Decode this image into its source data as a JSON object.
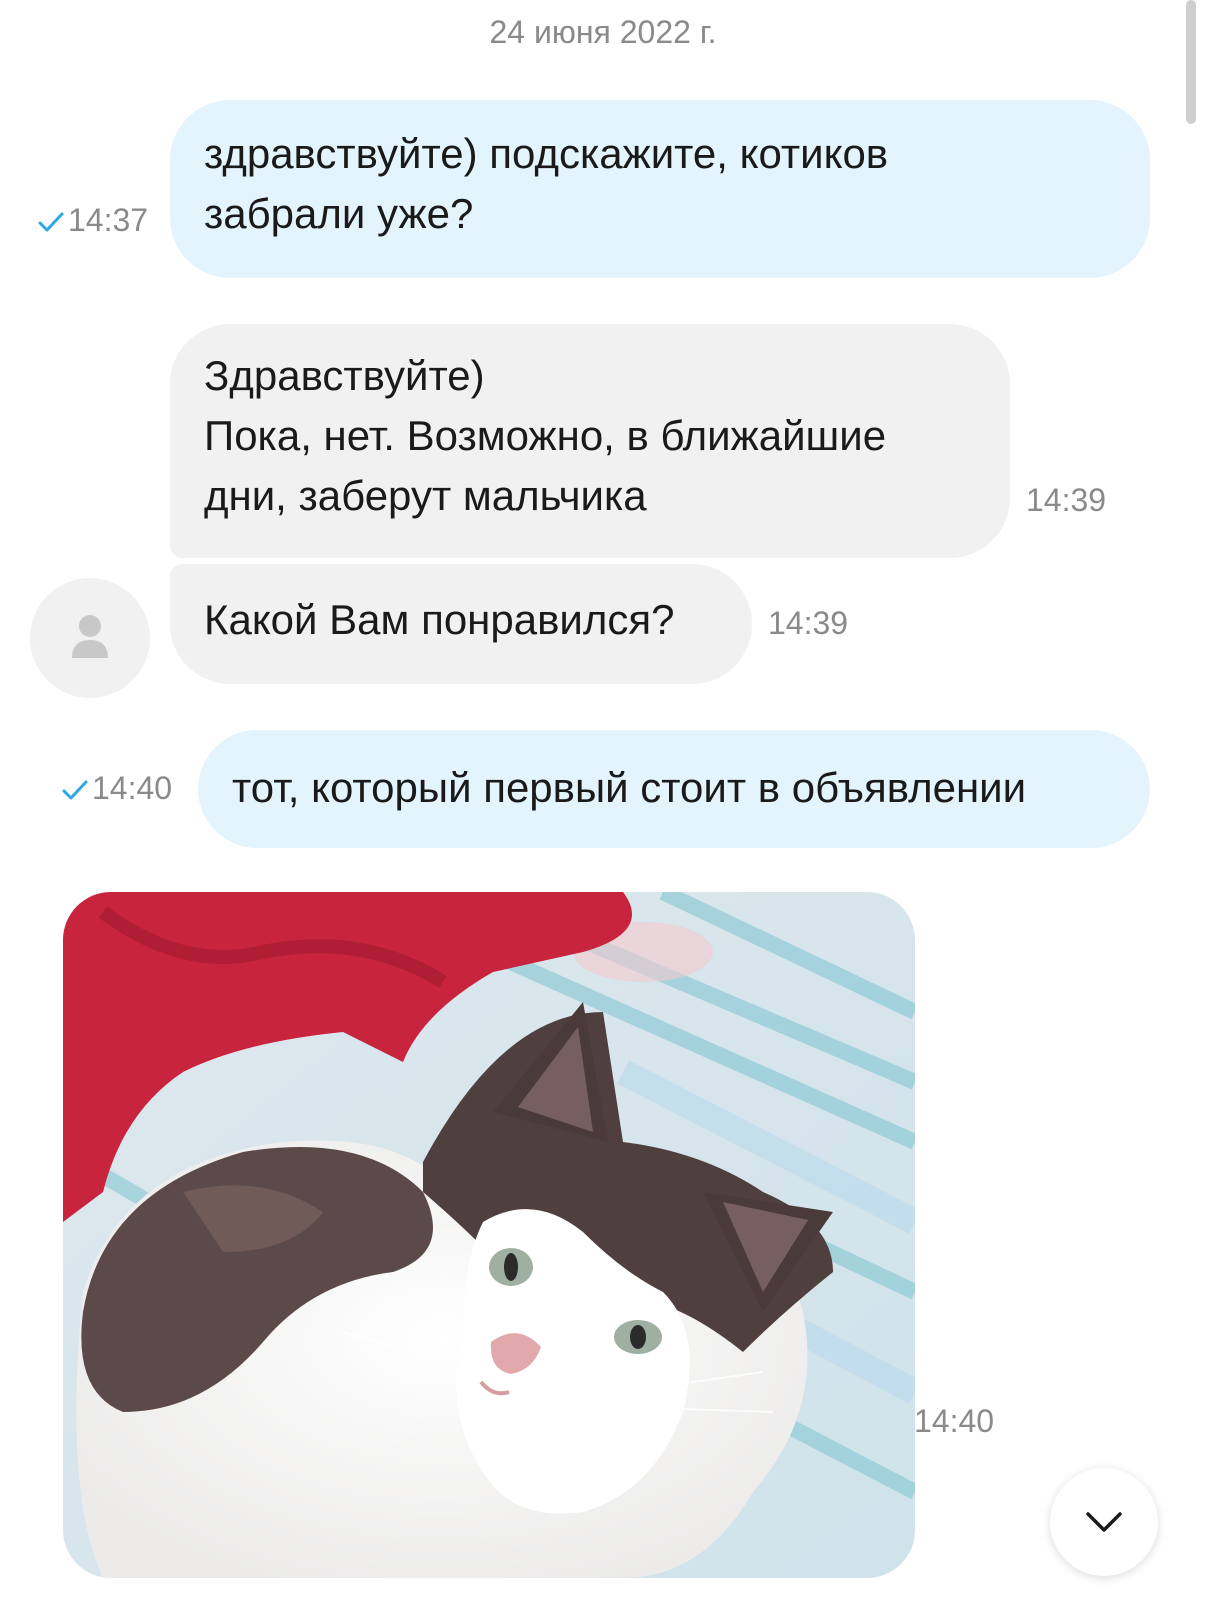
{
  "date_separator": "24 июня 2022 г.",
  "messages": [
    {
      "direction": "outgoing",
      "lines": [
        "здравствуйте) подскажите, котиков",
        "забрали уже?"
      ],
      "time": "14:37",
      "read": true
    },
    {
      "direction": "incoming",
      "lines": [
        "Здравствуйте)",
        "Пока, нет. Возможно, в ближайшие",
        "дни, заберут мальчика"
      ],
      "time": "14:39"
    },
    {
      "direction": "incoming",
      "lines": [
        "Какой Вам понравился?"
      ],
      "time": "14:39"
    },
    {
      "direction": "outgoing",
      "lines": [
        "тот, который первый стоит в объявлении"
      ],
      "time": "14:40",
      "read": true
    },
    {
      "direction": "incoming",
      "type": "photo",
      "time": "14:40"
    }
  ],
  "colors": {
    "outgoing_bubble": "#e3f4fd",
    "incoming_bubble": "#f1f1f1",
    "read_check": "#2ea7e6",
    "meta_text": "#8a8a8a"
  },
  "icons": {
    "read_check": "check-icon",
    "avatar_placeholder": "user-icon",
    "scroll_down": "chevron-down-icon"
  }
}
